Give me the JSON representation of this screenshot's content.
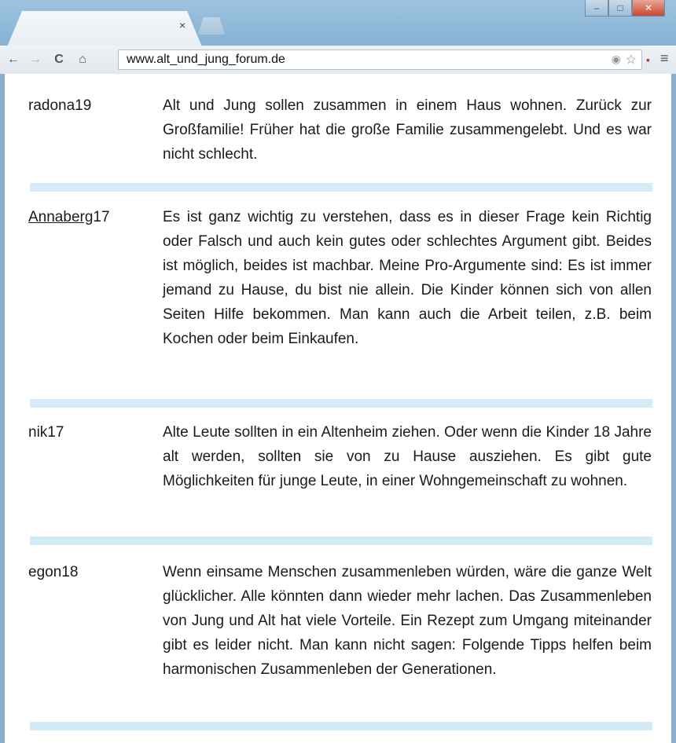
{
  "browser": {
    "url": "www.alt_und_jung_forum.de",
    "tab_close": "×",
    "back": "←",
    "forward": "→",
    "reload": "C",
    "home": "⌂",
    "star": "☆",
    "eye": "◉",
    "menu": "≡",
    "window_min": "–",
    "window_max": "□",
    "window_close": "✕"
  },
  "posts": [
    {
      "user": "radona19",
      "user_link": "",
      "user_suffix": "",
      "text": "Alt und Jung sollen zusammen in einem Haus wohnen. Zurück zur Großfamilie! Früher hat die große Familie zusammengelebt. Und es war nicht schlecht."
    },
    {
      "user": "Annaberg17",
      "user_link": "Annaberg",
      "user_suffix": "17",
      "text": "Es ist ganz wichtig zu verstehen, dass es in dieser Frage kein Richtig oder Falsch und auch kein gutes oder schlechtes Argument gibt. Beides ist möglich, beides ist machbar. Meine Pro-Argumente sind: Es ist immer jemand zu Hause, du bist nie allein. Die Kinder können sich von allen Seiten Hilfe bekommen. Man kann auch die Arbeit teilen, z.B. beim Kochen oder beim Einkaufen."
    },
    {
      "user": "nik17",
      "user_link": "",
      "user_suffix": "",
      "text": "Alte Leute sollten in ein Altenheim ziehen. Oder wenn die Kinder 18 Jahre alt werden, sollten sie von zu Hause ausziehen. Es gibt gute Möglichkeiten für junge Leute, in einer Wohngemeinschaft zu wohnen."
    },
    {
      "user": "egon18",
      "user_link": "",
      "user_suffix": "",
      "text": "Wenn einsame Menschen zusammenleben würden, wäre die ganze Welt glücklicher. Alle könnten dann wieder mehr lachen. Das Zusammenleben von Jung und Alt hat viele Vorteile. Ein Rezept zum Umgang miteinander gibt es leider nicht. Man kann nicht sagen: Folgende Tipps helfen beim harmonischen Zusammenleben der Generationen."
    }
  ],
  "colors": {
    "separator": "#d4eaf7",
    "frame": "#86afd0"
  }
}
